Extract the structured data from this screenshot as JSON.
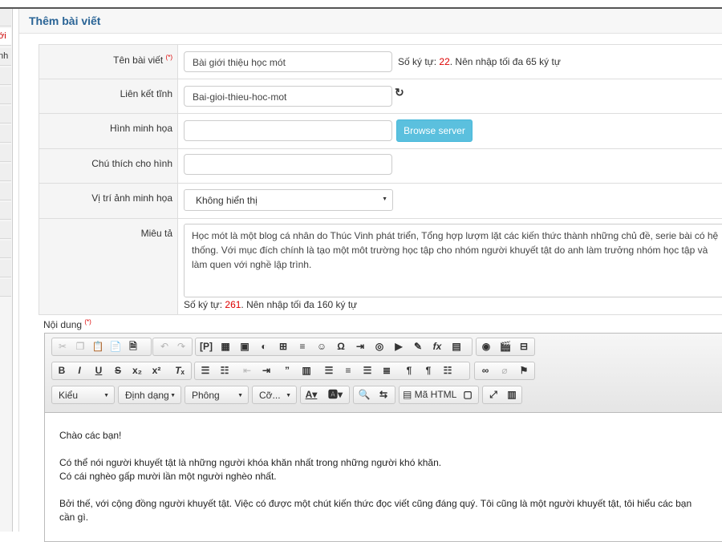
{
  "left_nav": {
    "items": [
      "ới",
      "nh"
    ]
  },
  "panel": {
    "title": "Thêm bài viết"
  },
  "form": {
    "title_label": "Tên bài viết",
    "required_mark": "(*)",
    "title_value": "Bài giới thiệu học mót",
    "title_hint_prefix": "Số ký tự: ",
    "title_hint_count": "22",
    "title_hint_suffix": ". Nên nhập tối đa 65 ký tự",
    "slug_label": "Liên kết tĩnh",
    "slug_value": "Bai-gioi-thieu-hoc-mot",
    "image_label": "Hình minh họa",
    "image_value": "",
    "browse_label": "Browse server",
    "caption_label": "Chú thích cho hình",
    "caption_value": "",
    "position_label": "Vị trí ảnh minh họa",
    "position_value": "Không hiển thị",
    "desc_label": "Miêu tả",
    "desc_value": "Học mót là một blog cá nhân do Thúc Vinh phát triển, Tổng hợp lượm lặt các kiến thức thành những chủ đề, serie bài có hệ thống. Với mục đích chính là tạo một môt trường học tập cho nhóm người khuyết tật do anh làm trưởng nhóm học tập và làm quen với nghề lập trình.",
    "desc_hint_prefix": "Số ký tự: ",
    "desc_hint_count": "261",
    "desc_hint_suffix": ". Nên nhập tối đa 160 ký tự",
    "content_label": "Nội dung"
  },
  "editor": {
    "format_combo": "Kiểu",
    "style_combo": "Định dạng",
    "font_combo": "Phông",
    "size_combo": "Cỡ...",
    "source_label": "Mã HTML",
    "content": [
      "Chào các bạn!",
      "",
      "Có thể nói người khuyết tật là những người khóa khăn nhất trong những người khó khăn.",
      "Có cái nghèo gấp mười lần một người nghèo nhất.",
      "",
      "Bởi thế, với cộng đồng người khuyết tật. Việc có được một chút kiến thức đọc viết cũng đáng quý. Tôi cũng là một người khuyết tật, tôi hiểu các bạn cần gì."
    ]
  }
}
